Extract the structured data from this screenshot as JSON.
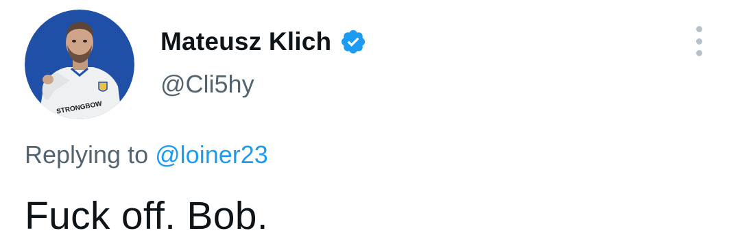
{
  "author": {
    "display_name": "Mateusz Klich",
    "handle": "@Cli5hy",
    "verified_icon": "verified-badge-icon",
    "avatar_shirt_text": "STRONGBOW"
  },
  "reply": {
    "prefix": "Replying to",
    "mention": "@loiner23"
  },
  "tweet": {
    "text": "Fuck off. Bob."
  },
  "colors": {
    "text_primary": "#0f1419",
    "text_secondary": "#536471",
    "link": "#1d9bf0",
    "verified": "#1d9bf0",
    "avatar_background": "#1f4fa6"
  }
}
